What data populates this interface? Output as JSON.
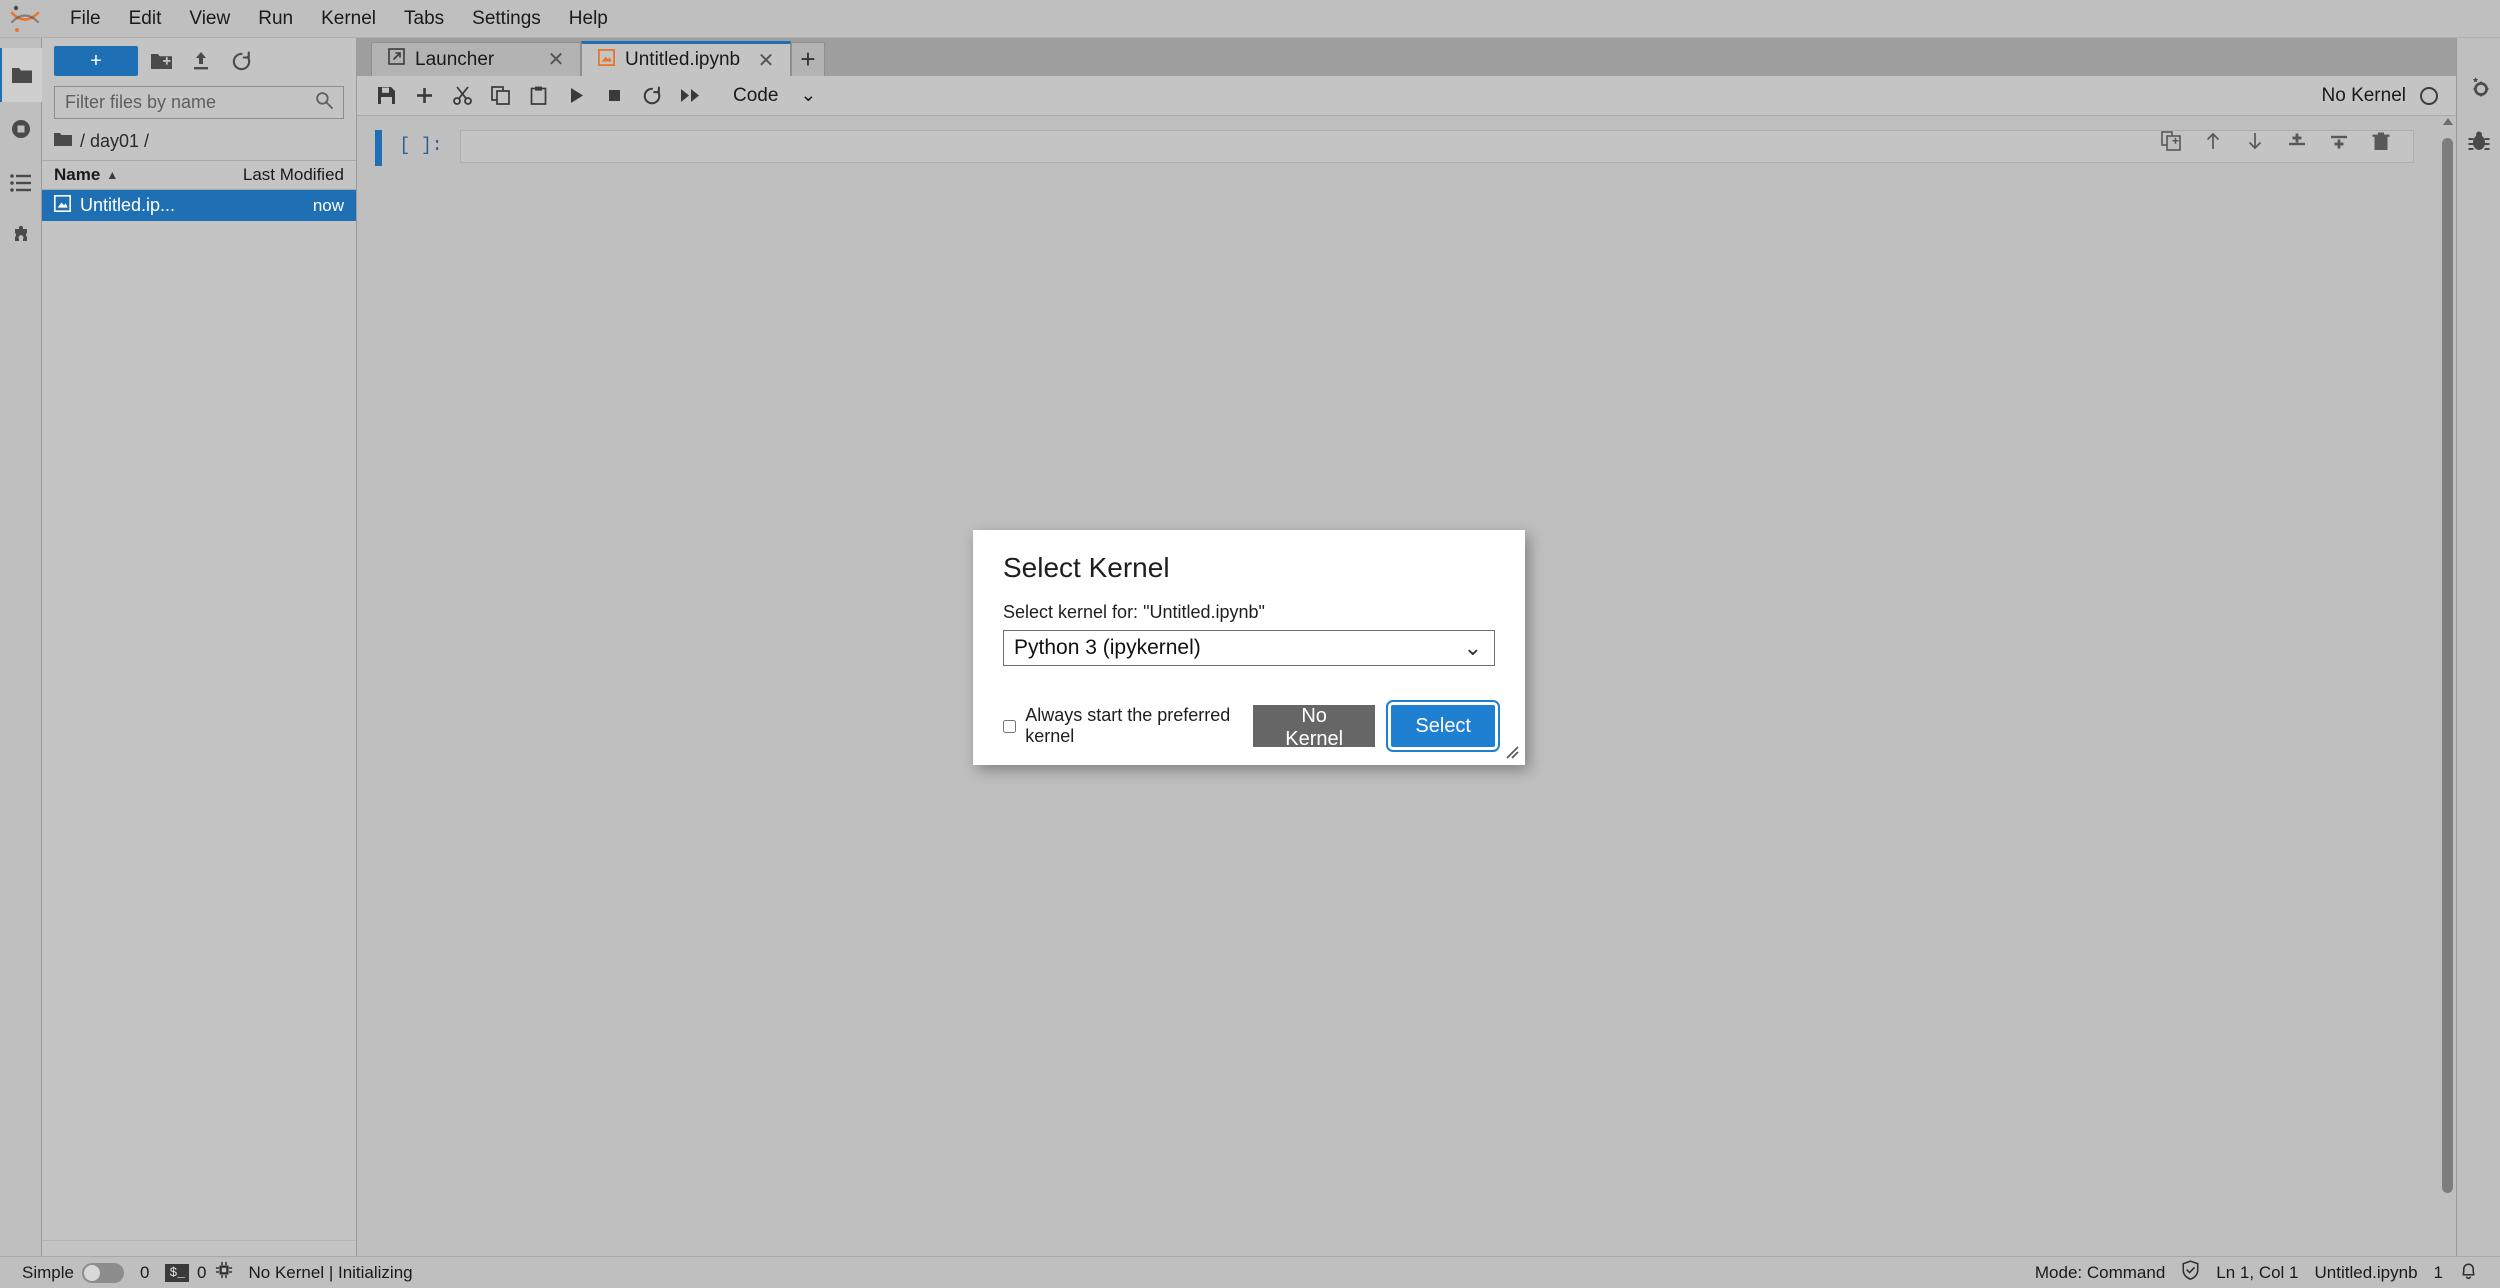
{
  "app": {
    "logo_name": "jupyter-logo",
    "accent": "#1f6fb5",
    "dialog_accent": "#1f7fd1"
  },
  "menubar": {
    "items": [
      {
        "label": "File"
      },
      {
        "label": "Edit"
      },
      {
        "label": "View"
      },
      {
        "label": "Run"
      },
      {
        "label": "Kernel"
      },
      {
        "label": "Tabs"
      },
      {
        "label": "Settings"
      },
      {
        "label": "Help"
      }
    ]
  },
  "left_activity_bar": {
    "items": [
      {
        "icon": "folder-icon",
        "name": "file-browser",
        "active": true
      },
      {
        "icon": "running-stop-icon",
        "name": "running-terminals-kernels",
        "active": false
      },
      {
        "icon": "list-icon",
        "name": "table-of-contents",
        "active": false
      },
      {
        "icon": "puzzle-icon",
        "name": "extension-manager",
        "active": false
      }
    ]
  },
  "right_activity_bar": {
    "items": [
      {
        "icon": "gears-icon",
        "name": "property-inspector"
      },
      {
        "icon": "bug-icon",
        "name": "debugger"
      }
    ]
  },
  "file_browser": {
    "new_launcher_label": "+",
    "toolbar_icons": [
      {
        "icon": "new-folder-icon",
        "name": "new-folder-button"
      },
      {
        "icon": "upload-icon",
        "name": "upload-files-button"
      },
      {
        "icon": "refresh-icon",
        "name": "refresh-file-list-button"
      }
    ],
    "filter_placeholder": "Filter files by name",
    "filter_value": "",
    "search_icon": "search-icon",
    "breadcrumb": "/ day01 /",
    "columns": {
      "name": "Name",
      "last_modified": "Last Modified"
    },
    "sort_indicator": "▲",
    "rows": [
      {
        "icon": "notebook-icon",
        "name": "Untitled.ip...",
        "modified": "now",
        "selected": true
      }
    ]
  },
  "tabs": {
    "items": [
      {
        "label": "Launcher",
        "icon": "launcher-icon",
        "active": false,
        "close": "✕"
      },
      {
        "label": "Untitled.ipynb",
        "icon": "notebook-icon",
        "active": true,
        "close": "✕"
      }
    ],
    "add_label": "+"
  },
  "notebook_toolbar": {
    "buttons": [
      {
        "icon": "save-icon",
        "name": "save-button"
      },
      {
        "icon": "plus-icon",
        "name": "insert-cell-button"
      },
      {
        "icon": "scissors-icon",
        "name": "cut-cells-button"
      },
      {
        "icon": "copy-icon",
        "name": "copy-cells-button"
      },
      {
        "icon": "paste-icon",
        "name": "paste-cells-button"
      },
      {
        "icon": "play-icon",
        "name": "run-cell-button"
      },
      {
        "icon": "stop-icon",
        "name": "interrupt-kernel-button"
      },
      {
        "icon": "restart-icon",
        "name": "restart-kernel-button"
      },
      {
        "icon": "fast-forward-icon",
        "name": "restart-and-run-all-button"
      }
    ],
    "cell_type": "Code",
    "cell_type_caret": "⌄",
    "kernel_name": "No Kernel",
    "kernel_status_icon": "kernel-idle-circle-icon"
  },
  "notebook": {
    "cells": [
      {
        "prompt": "[ ]:",
        "source": "",
        "active": true
      }
    ],
    "cell_actions": [
      {
        "icon": "duplicate-cell-icon",
        "name": "duplicate-cell-button"
      },
      {
        "icon": "arrow-up-icon",
        "name": "move-cell-up-button"
      },
      {
        "icon": "arrow-down-icon",
        "name": "move-cell-down-button"
      },
      {
        "icon": "insert-above-icon",
        "name": "insert-cell-above-button"
      },
      {
        "icon": "insert-below-icon",
        "name": "insert-cell-below-button"
      },
      {
        "icon": "trash-icon",
        "name": "delete-cell-button"
      }
    ]
  },
  "dialog": {
    "title": "Select Kernel",
    "label": "Select kernel for: \"Untitled.ipynb\"",
    "select_value": "Python 3 (ipykernel)",
    "select_caret": "⌄",
    "checkbox_label": "Always start the preferred kernel",
    "checkbox_checked": false,
    "cancel_label": "No Kernel",
    "confirm_label": "Select"
  },
  "statusbar": {
    "simple_label": "Simple",
    "simple_on": false,
    "kernel_count": "0",
    "terminal_badge": "$_",
    "terminal_count": "0",
    "cpu_icon": "chip-icon",
    "kernel_status": "No Kernel | Initializing",
    "mode": "Mode: Command",
    "shield_icon": "shield-check-icon",
    "cursor_position": "Ln 1, Col 1",
    "filename": "Untitled.ipynb",
    "cell_count": "1",
    "bell_icon": "bell-icon"
  }
}
